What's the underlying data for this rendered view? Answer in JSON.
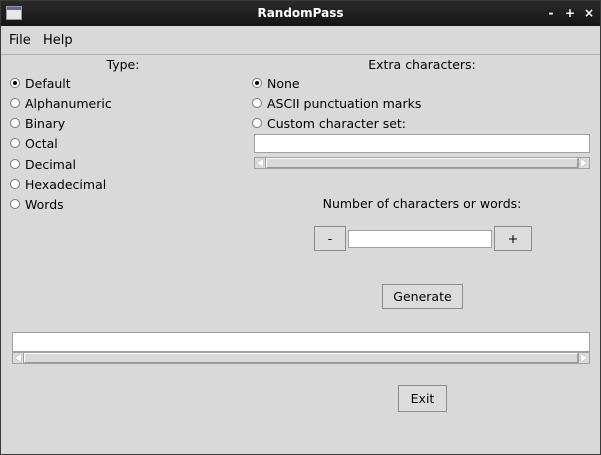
{
  "window": {
    "title": "RandomPass",
    "buttons": {
      "minimize": "-",
      "maximize": "+",
      "close": "×"
    }
  },
  "menubar": {
    "items": [
      "File",
      "Help"
    ]
  },
  "type_section": {
    "heading": "Type:",
    "options": [
      "Default",
      "Alphanumeric",
      "Binary",
      "Octal",
      "Decimal",
      "Hexadecimal",
      "Words"
    ],
    "selected": "Default"
  },
  "extra_section": {
    "heading": "Extra characters:",
    "options": [
      "None",
      "ASCII punctuation marks",
      "Custom character set:"
    ],
    "selected": "None",
    "custom_value": ""
  },
  "length_section": {
    "heading": "Number of characters or words:",
    "decrement_label": "-",
    "increment_label": "+",
    "value": ""
  },
  "generate_label": "Generate",
  "output_value": "",
  "exit_label": "Exit"
}
